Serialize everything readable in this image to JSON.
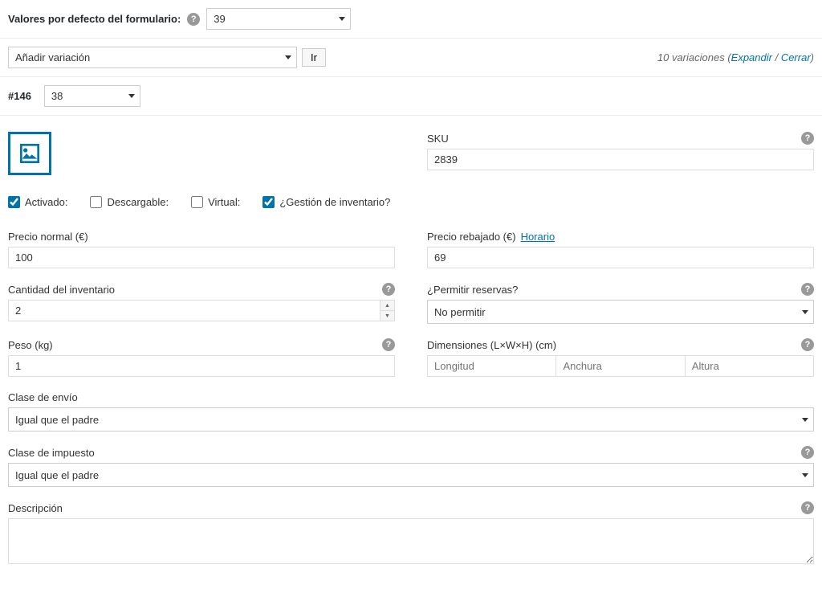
{
  "defaults": {
    "label": "Valores por defecto del formulario:",
    "value": "39"
  },
  "variation_actions": {
    "selected": "Añadir variación",
    "go_button": "Ir"
  },
  "variations_summary": {
    "count_text": "10 variaciones (",
    "expand": "Expandir",
    "sep": " / ",
    "close": "Cerrar",
    "tail": ")"
  },
  "variation": {
    "id": "#146",
    "attr_value": "38",
    "sku": {
      "label": "SKU",
      "value": "2839"
    },
    "checkboxes": {
      "activado": {
        "label": "Activado:",
        "checked": true
      },
      "descargable": {
        "label": "Descargable:",
        "checked": false
      },
      "virtual": {
        "label": "Virtual:",
        "checked": false
      },
      "inventario": {
        "label": "¿Gestión de inventario?",
        "checked": true
      }
    },
    "regular_price": {
      "label": "Precio normal (€)",
      "value": "100"
    },
    "sale_price": {
      "label": "Precio rebajado (€)",
      "schedule": "Horario",
      "value": "69"
    },
    "stock_qty": {
      "label": "Cantidad del inventario",
      "value": "2"
    },
    "backorders": {
      "label": "¿Permitir reservas?",
      "value": "No permitir"
    },
    "weight": {
      "label": "Peso (kg)",
      "value": "1"
    },
    "dimensions": {
      "label": "Dimensiones (L×W×H) (cm)",
      "length_ph": "Longitud",
      "width_ph": "Anchura",
      "height_ph": "Altura"
    },
    "shipping_class": {
      "label": "Clase de envío",
      "value": "Igual que el padre"
    },
    "tax_class": {
      "label": "Clase de impuesto",
      "value": "Igual que el padre"
    },
    "description": {
      "label": "Descripción",
      "value": ""
    }
  }
}
